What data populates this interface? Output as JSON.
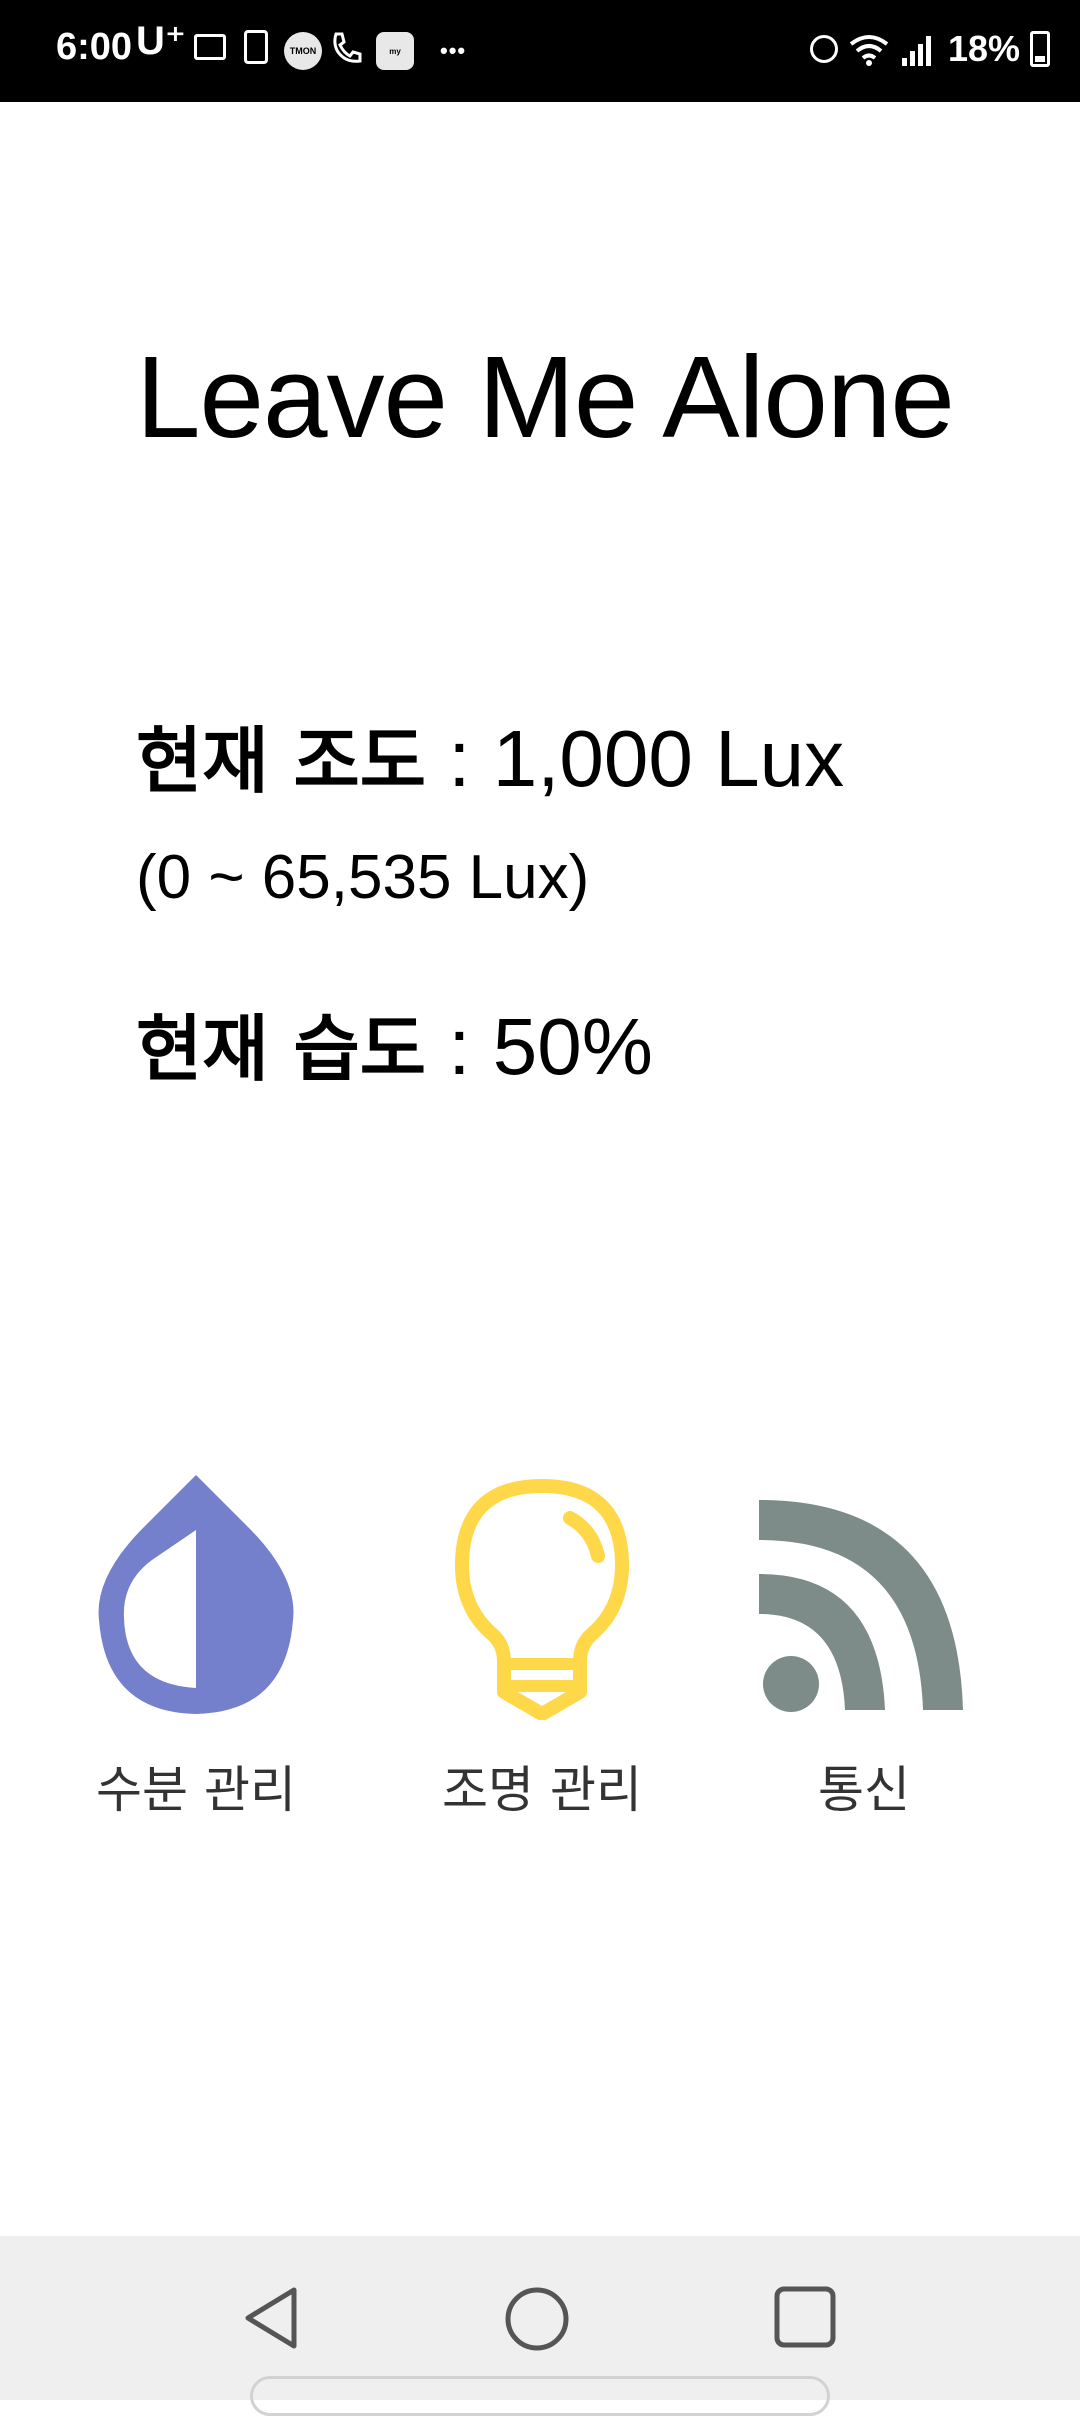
{
  "status_bar": {
    "time": "6:00",
    "carrier": "U⁺",
    "notification_icons": [
      "message-icon",
      "suitcase-icon",
      "tmon-icon",
      "phone-icon",
      "who-app-icon",
      "my-app-icon"
    ],
    "more_indicator": "•••",
    "battery_percent": "18%",
    "battery_level": 0.18
  },
  "main": {
    "title": "Leave Me Alone",
    "illuminance_label": "현재 조도",
    "illuminance_value": " : 1,000 Lux",
    "illuminance_range": "(0 ~ 65,535 Lux)",
    "humidity_label": "현재 습도",
    "humidity_value": " : 50%"
  },
  "menu": {
    "water_label": "수분 관리",
    "light_label": "조명 관리",
    "comm_label": "통신"
  },
  "colors": {
    "water_icon": "#7580CC",
    "light_icon": "#FFD84A",
    "comm_icon": "#7E8C89"
  }
}
